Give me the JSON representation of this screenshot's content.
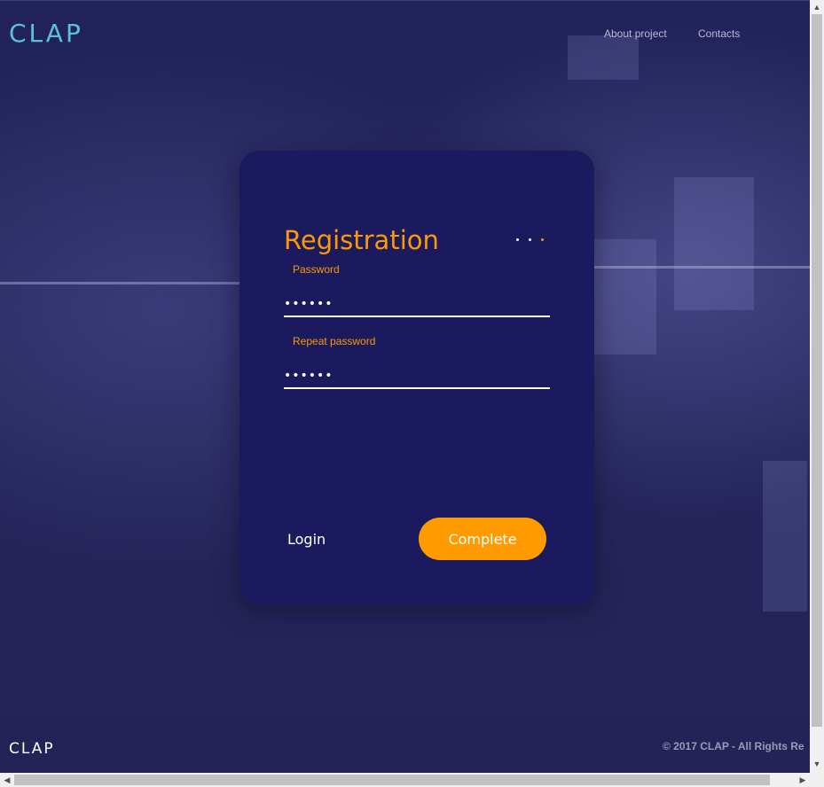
{
  "header": {
    "logo": "CLAP",
    "nav": [
      "About project",
      "Contacts"
    ]
  },
  "form": {
    "title": "Registration",
    "step_dots": {
      "count": 3,
      "active_index": 2,
      "active_color": "#ff9900",
      "inactive_color": "#ffffff"
    },
    "fields": [
      {
        "label": "Password",
        "value": "••••••"
      },
      {
        "label": "Repeat password",
        "value": "••••••"
      }
    ],
    "login_label": "Login",
    "complete_label": "Complete"
  },
  "footer": {
    "logo": "CLAP",
    "copyright": "© 2017 CLAP - All Rights Re"
  },
  "colors": {
    "accent": "#ff9900",
    "card_bg": "#1b1a5e",
    "page_bg": "#232357",
    "logo": "#5bc1d9"
  }
}
